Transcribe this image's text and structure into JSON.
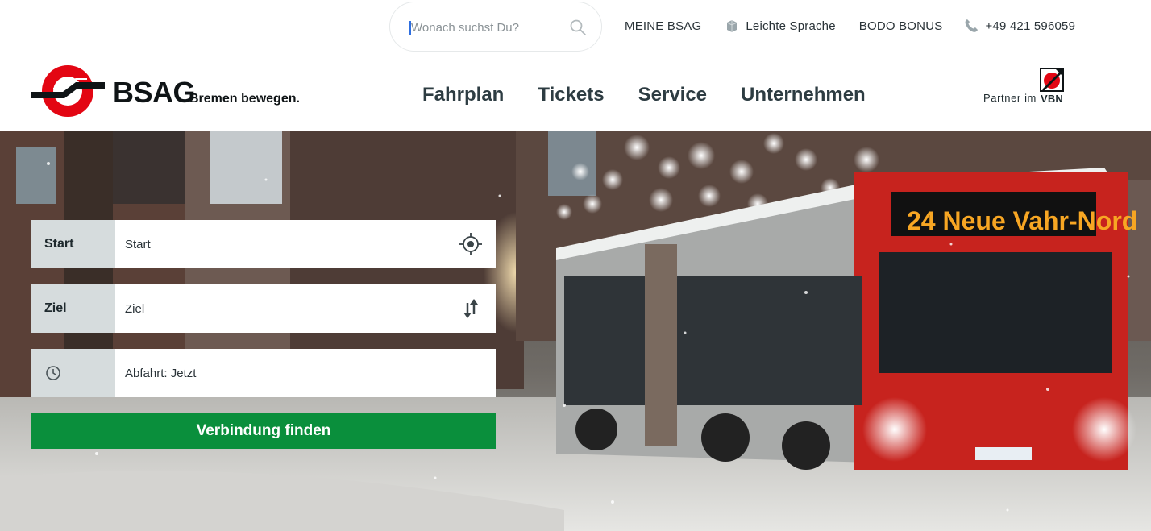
{
  "search": {
    "placeholder": "Wonach suchst Du?"
  },
  "toplinks": {
    "meine": "MEINE BSAG",
    "leichte": "Leichte Sprache",
    "bonus": "BODO BONUS",
    "phone": "+49 421 596059"
  },
  "brand": {
    "name": "BSAG",
    "tagline": "Bremen bewegen."
  },
  "nav": [
    "Fahrplan",
    "Tickets",
    "Service",
    "Unternehmen"
  ],
  "partner": {
    "text": "Partner im",
    "label": "VBN"
  },
  "form": {
    "start_label": "Start",
    "start_placeholder": "Start",
    "ziel_label": "Ziel",
    "ziel_placeholder": "Ziel",
    "time_value": "Abfahrt: Jetzt",
    "submit_label": "Verbindung finden"
  },
  "hero": {
    "bus_destination": "24 Neue Vahr-Nord"
  },
  "colors": {
    "brand_red": "#e30613",
    "submit_green": "#0a8f3c",
    "label_gray": "#d6dcdd"
  }
}
